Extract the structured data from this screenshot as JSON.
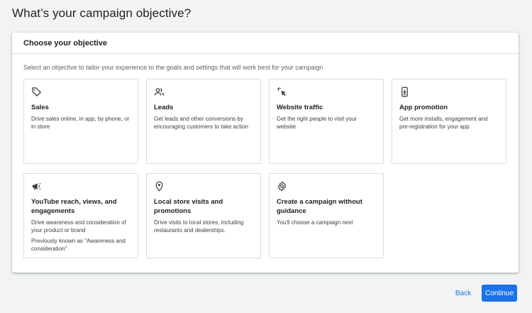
{
  "page": {
    "title": "What’s your campaign objective?"
  },
  "panel": {
    "header": "Choose your objective",
    "subtitle": "Select an objective to tailor your experience to the goals and settings that will work best for your campaign"
  },
  "objectives": [
    {
      "icon": "tag-icon",
      "title": "Sales",
      "description": "Drive sales online, in app, by phone, or in store"
    },
    {
      "icon": "people-icon",
      "title": "Leads",
      "description": "Get leads and other conversions by encouraging customers to take action"
    },
    {
      "icon": "cursor-click-icon",
      "title": "Website traffic",
      "description": "Get the right people to visit your website"
    },
    {
      "icon": "phone-download-icon",
      "title": "App promotion",
      "description": "Get more installs, engagement and pre-registration for your app"
    },
    {
      "icon": "megaphone-icon",
      "title": "YouTube reach, views, and engagements",
      "description": "Drive awareness and consideration of your product or brand",
      "note": "Previously known as \"Awareness and consideration\""
    },
    {
      "icon": "location-pin-icon",
      "title": "Local store visits and promotions",
      "description": "Drive visits to local stores, including restaurants and dealerships."
    },
    {
      "icon": "gear-icon",
      "title": "Create a campaign without guidance",
      "description": "You'll choose a campaign next"
    }
  ],
  "actions": {
    "back_label": "Back",
    "continue_label": "Continue"
  },
  "colors": {
    "accent": "#1a73e8",
    "background": "#f1f3f4",
    "border": "#dadce0"
  }
}
